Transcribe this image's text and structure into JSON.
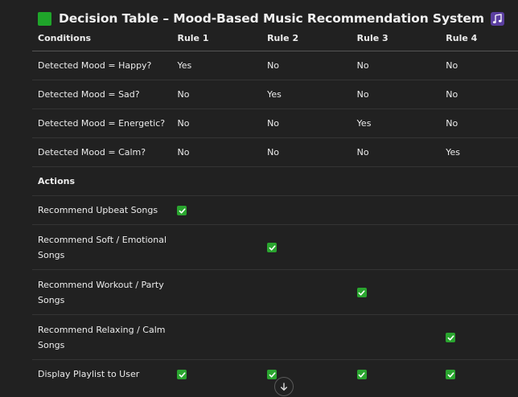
{
  "title": "Decision Table – Mood-Based Music Recommendation System",
  "icons": {
    "title_left": "green-square-icon",
    "title_right": "musical-notes-icon",
    "check": "green-checkmark-icon",
    "scroll": "arrow-down-icon"
  },
  "colors": {
    "background": "#212121",
    "green": "#2aa52f",
    "music_icon_bg": "#5b3fa0"
  },
  "headers": {
    "conditions": "Conditions",
    "rule1": "Rule 1",
    "rule2": "Rule 2",
    "rule3": "Rule 3",
    "rule4": "Rule 4"
  },
  "conditions": [
    {
      "label": "Detected Mood = Happy?",
      "values": [
        "Yes",
        "No",
        "No",
        "No"
      ]
    },
    {
      "label": "Detected Mood = Sad?",
      "values": [
        "No",
        "Yes",
        "No",
        "No"
      ]
    },
    {
      "label": "Detected Mood = Energetic?",
      "values": [
        "No",
        "No",
        "Yes",
        "No"
      ]
    },
    {
      "label": "Detected Mood = Calm?",
      "values": [
        "No",
        "No",
        "No",
        "Yes"
      ]
    }
  ],
  "actions_label": "Actions",
  "actions": [
    {
      "label": "Recommend Upbeat Songs",
      "checks": [
        true,
        false,
        false,
        false
      ]
    },
    {
      "label": "Recommend Soft / Emotional Songs",
      "checks": [
        false,
        true,
        false,
        false
      ]
    },
    {
      "label": "Recommend Workout / Party Songs",
      "checks": [
        false,
        false,
        true,
        false
      ]
    },
    {
      "label": "Recommend Relaxing / Calm Songs",
      "checks": [
        false,
        false,
        false,
        true
      ]
    },
    {
      "label": "Display Playlist to User",
      "checks": [
        true,
        true,
        true,
        true
      ]
    }
  ]
}
